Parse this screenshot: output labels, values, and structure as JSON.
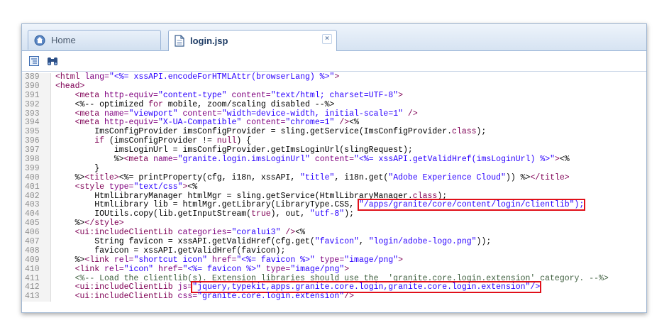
{
  "tabs": [
    {
      "label": "Home",
      "icon": "home-icon"
    },
    {
      "label": "login.jsp",
      "icon": "file-icon",
      "close": "×"
    }
  ],
  "toolbar": [
    {
      "icon": "format-icon"
    },
    {
      "icon": "binoculars-icon"
    }
  ],
  "colors": {
    "tag": "#7f0055",
    "attr": "#7f007f",
    "string": "#2a00ff",
    "highlight": "#e0101a"
  },
  "code": {
    "lines": [
      {
        "n": "389",
        "ind": "",
        "segs": [
          [
            "tag",
            "<html "
          ],
          [
            "attr",
            "lang="
          ],
          [
            "str",
            "\"<%= xssAPI.encodeForHTMLAttr(browserLang) %>\""
          ],
          [
            "tag",
            ">"
          ]
        ]
      },
      {
        "n": "390",
        "ind": "",
        "segs": [
          [
            "tag",
            "<head>"
          ]
        ]
      },
      {
        "n": "391",
        "ind": "    ",
        "segs": [
          [
            "tag",
            "<meta "
          ],
          [
            "attr",
            "http-equiv="
          ],
          [
            "str",
            "\"content-type\""
          ],
          [
            "attr",
            " content="
          ],
          [
            "str",
            "\"text/html; charset=UTF-8\""
          ],
          [
            "tag",
            ">"
          ]
        ]
      },
      {
        "n": "392",
        "ind": "    ",
        "segs": [
          [
            "txt",
            "<%-- optimized "
          ],
          [
            "kw",
            "for"
          ],
          [
            "txt",
            " mobile, zoom/scaling disabled --%>"
          ]
        ]
      },
      {
        "n": "393",
        "ind": "    ",
        "segs": [
          [
            "tag",
            "<meta "
          ],
          [
            "attr",
            "name="
          ],
          [
            "str",
            "\"viewport\""
          ],
          [
            "attr",
            " content="
          ],
          [
            "str",
            "\"width=device-width, initial-scale=1\""
          ],
          [
            "tag",
            " />"
          ]
        ]
      },
      {
        "n": "394",
        "ind": "    ",
        "segs": [
          [
            "tag",
            "<meta "
          ],
          [
            "attr",
            "http-equiv="
          ],
          [
            "str",
            "\"X-UA-Compatible\""
          ],
          [
            "attr",
            " content="
          ],
          [
            "str",
            "\"chrome=1\""
          ],
          [
            "tag",
            " />"
          ],
          [
            "txt",
            "<%"
          ]
        ]
      },
      {
        "n": "395",
        "ind": "        ",
        "segs": [
          [
            "txt",
            "ImsConfigProvider imsConfigProvider = sling.getService(ImsConfigProvider."
          ],
          [
            "kw",
            "class"
          ],
          [
            "txt",
            ");"
          ]
        ]
      },
      {
        "n": "396",
        "ind": "        ",
        "segs": [
          [
            "kw",
            "if"
          ],
          [
            "txt",
            " (imsConfigProvider != "
          ],
          [
            "kw",
            "null"
          ],
          [
            "txt",
            ") {"
          ]
        ]
      },
      {
        "n": "397",
        "ind": "            ",
        "segs": [
          [
            "txt",
            "imsLoginUrl = imsConfigProvider.getImsLoginUrl(slingRequest);"
          ]
        ]
      },
      {
        "n": "398",
        "ind": "            ",
        "segs": [
          [
            "txt",
            "%>"
          ],
          [
            "tag",
            "<meta "
          ],
          [
            "attr",
            "name="
          ],
          [
            "str",
            "\"granite.login.imsLoginUrl\""
          ],
          [
            "attr",
            " content="
          ],
          [
            "str",
            "\"<%= xssAPI.getValidHref(imsLoginUrl) %>\""
          ],
          [
            "tag",
            ">"
          ],
          [
            "txt",
            "<%"
          ]
        ]
      },
      {
        "n": "399",
        "ind": "        ",
        "segs": [
          [
            "txt",
            "}"
          ]
        ]
      },
      {
        "n": "400",
        "ind": "    ",
        "segs": [
          [
            "txt",
            "%>"
          ],
          [
            "tag",
            "<title>"
          ],
          [
            "txt",
            "<%= printProperty(cfg, i18n, xssAPI, "
          ],
          [
            "str",
            "\"title\""
          ],
          [
            "txt",
            ", i18n.get("
          ],
          [
            "str",
            "\"Adobe Experience Cloud\""
          ],
          [
            "txt",
            ")) %>"
          ],
          [
            "tag",
            "</title>"
          ]
        ]
      },
      {
        "n": "401",
        "ind": "    ",
        "segs": [
          [
            "tag",
            "<style "
          ],
          [
            "attr",
            "type="
          ],
          [
            "str",
            "\"text/css\""
          ],
          [
            "tag",
            ">"
          ],
          [
            "txt",
            "<%"
          ]
        ]
      },
      {
        "n": "402",
        "ind": "        ",
        "segs": [
          [
            "txt",
            "HtmlLibraryManager htmlMgr = sling.getService(HtmlLibraryManager."
          ],
          [
            "kw",
            "class"
          ],
          [
            "txt",
            ");"
          ]
        ]
      },
      {
        "n": "403",
        "ind": "        ",
        "segs": [
          [
            "txt",
            "HtmlLibrary lib = htmlMgr.getLibrary(LibraryType.CSS, "
          ],
          [
            "hlstr",
            "\"/apps/granite/core/content/login/clientlib\");"
          ]
        ]
      },
      {
        "n": "404",
        "ind": "        ",
        "segs": [
          [
            "txt",
            "IOUtils.copy(lib.getInputStream("
          ],
          [
            "kw",
            "true"
          ],
          [
            "txt",
            "), out, "
          ],
          [
            "str",
            "\"utf-8\""
          ],
          [
            "txt",
            ");"
          ]
        ]
      },
      {
        "n": "405",
        "ind": "    ",
        "segs": [
          [
            "txt",
            "%>"
          ],
          [
            "tag",
            "</style>"
          ]
        ]
      },
      {
        "n": "406",
        "ind": "    ",
        "segs": [
          [
            "tag",
            "<ui:includeClientLib "
          ],
          [
            "attr",
            "categories="
          ],
          [
            "str",
            "\"coralui3\""
          ],
          [
            "tag",
            " />"
          ],
          [
            "txt",
            "<%"
          ]
        ]
      },
      {
        "n": "407",
        "ind": "        ",
        "segs": [
          [
            "txt",
            "String favicon = xssAPI.getValidHref(cfg.get("
          ],
          [
            "str",
            "\"favicon\""
          ],
          [
            "txt",
            ", "
          ],
          [
            "str",
            "\"login/adobe-logo.png\""
          ],
          [
            "txt",
            "));"
          ]
        ]
      },
      {
        "n": "408",
        "ind": "        ",
        "segs": [
          [
            "txt",
            "favicon = xssAPI.getValidHref(favicon);"
          ]
        ]
      },
      {
        "n": "409",
        "ind": "    ",
        "segs": [
          [
            "txt",
            "%>"
          ],
          [
            "tag",
            "<link "
          ],
          [
            "attr",
            "rel="
          ],
          [
            "str",
            "\"shortcut icon\""
          ],
          [
            "attr",
            " href="
          ],
          [
            "str",
            "\"<%= favicon %>\""
          ],
          [
            "attr",
            " type="
          ],
          [
            "str",
            "\"image/png\""
          ],
          [
            "tag",
            ">"
          ]
        ]
      },
      {
        "n": "410",
        "ind": "    ",
        "segs": [
          [
            "tag",
            "<link "
          ],
          [
            "attr",
            "rel="
          ],
          [
            "str",
            "\"icon\""
          ],
          [
            "attr",
            " href="
          ],
          [
            "str",
            "\"<%= favicon %>\""
          ],
          [
            "attr",
            " type="
          ],
          [
            "str",
            "\"image/png\""
          ],
          [
            "tag",
            ">"
          ]
        ]
      },
      {
        "n": "411",
        "ind": "    ",
        "segs": [
          [
            "cm",
            "<%-- Load the clientlib(s). Extension libraries should use the  'granite.core.login.extension' category. --%>"
          ]
        ]
      },
      {
        "n": "412",
        "ind": "    ",
        "segs": [
          [
            "tag",
            "<ui:includeClientLib "
          ],
          [
            "attr",
            "js="
          ],
          [
            "hlstr",
            "\"jquery,typekit,apps.granite.core.login,granite.core.login.extension\"/>"
          ]
        ]
      },
      {
        "n": "413",
        "ind": "    ",
        "segs": [
          [
            "tag",
            "<ui:includeClientLib "
          ],
          [
            "attr",
            "css="
          ],
          [
            "str",
            "\"granite.core.login.extension\""
          ],
          [
            "tag",
            "/>"
          ]
        ]
      }
    ]
  }
}
